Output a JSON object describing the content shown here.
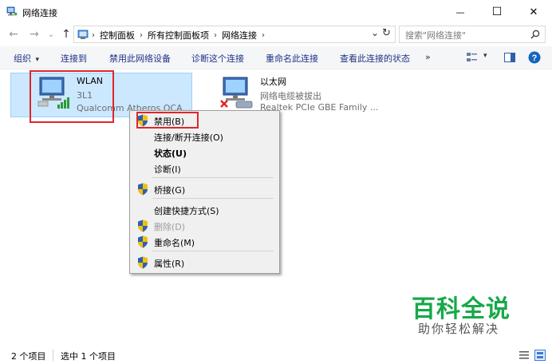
{
  "window": {
    "title": "网络连接",
    "min_glyph": "—",
    "max_glyph": "☐",
    "close_glyph": "✕"
  },
  "nav": {
    "back": "←",
    "forward": "→",
    "history": "⌄",
    "up": "↑",
    "breadcrumb": [
      "控制面板",
      "所有控制面板项",
      "网络连接"
    ],
    "crumb_sep": "›",
    "dropdown": "⌄",
    "refresh": "↻",
    "search_placeholder": "搜索\"网络连接\"",
    "search_icon": "search-icon"
  },
  "commands": {
    "organize": "组织",
    "organize_arrow": "▾",
    "connect_to": "连接到",
    "disable_device": "禁用此网络设备",
    "diagnose": "诊断这个连接",
    "rename": "重命名此连接",
    "view_status": "查看此连接的状态",
    "more": "»",
    "view_menu_arrow": "▾"
  },
  "connections": [
    {
      "name": "WLAN",
      "status": "3L1",
      "adapter": "Qualcomm Atheros QCA...",
      "selected": true
    },
    {
      "name": "以太网",
      "status": "网络电缆被拔出",
      "adapter": "Realtek PCIe GBE Family ...",
      "selected": false
    }
  ],
  "context_menu": [
    {
      "label": "禁用(B)",
      "shield": true,
      "disabled": false,
      "bold": false,
      "highlighted": true
    },
    {
      "label": "连接/断开连接(O)",
      "shield": false,
      "disabled": false,
      "bold": false
    },
    {
      "label": "状态(U)",
      "shield": false,
      "disabled": false,
      "bold": true
    },
    {
      "label": "诊断(I)",
      "shield": false,
      "disabled": false,
      "bold": false
    },
    {
      "label": "桥接(G)",
      "shield": true,
      "disabled": false,
      "bold": false
    },
    {
      "label": "创建快捷方式(S)",
      "shield": false,
      "disabled": false,
      "bold": false
    },
    {
      "label": "删除(D)",
      "shield": true,
      "disabled": true,
      "bold": false
    },
    {
      "label": "重命名(M)",
      "shield": true,
      "disabled": false,
      "bold": false
    },
    {
      "label": "属性(R)",
      "shield": true,
      "disabled": false,
      "bold": false
    }
  ],
  "status": {
    "item_count": "2 个项目",
    "selected_count": "选中 1 个项目"
  },
  "watermark": {
    "title": "百科全说",
    "subtitle": "助你轻松解决"
  },
  "colors": {
    "accent": "#1e3287",
    "selection": "#cce8ff",
    "highlight_box": "#e0262b",
    "watermark": "#17a84a"
  }
}
